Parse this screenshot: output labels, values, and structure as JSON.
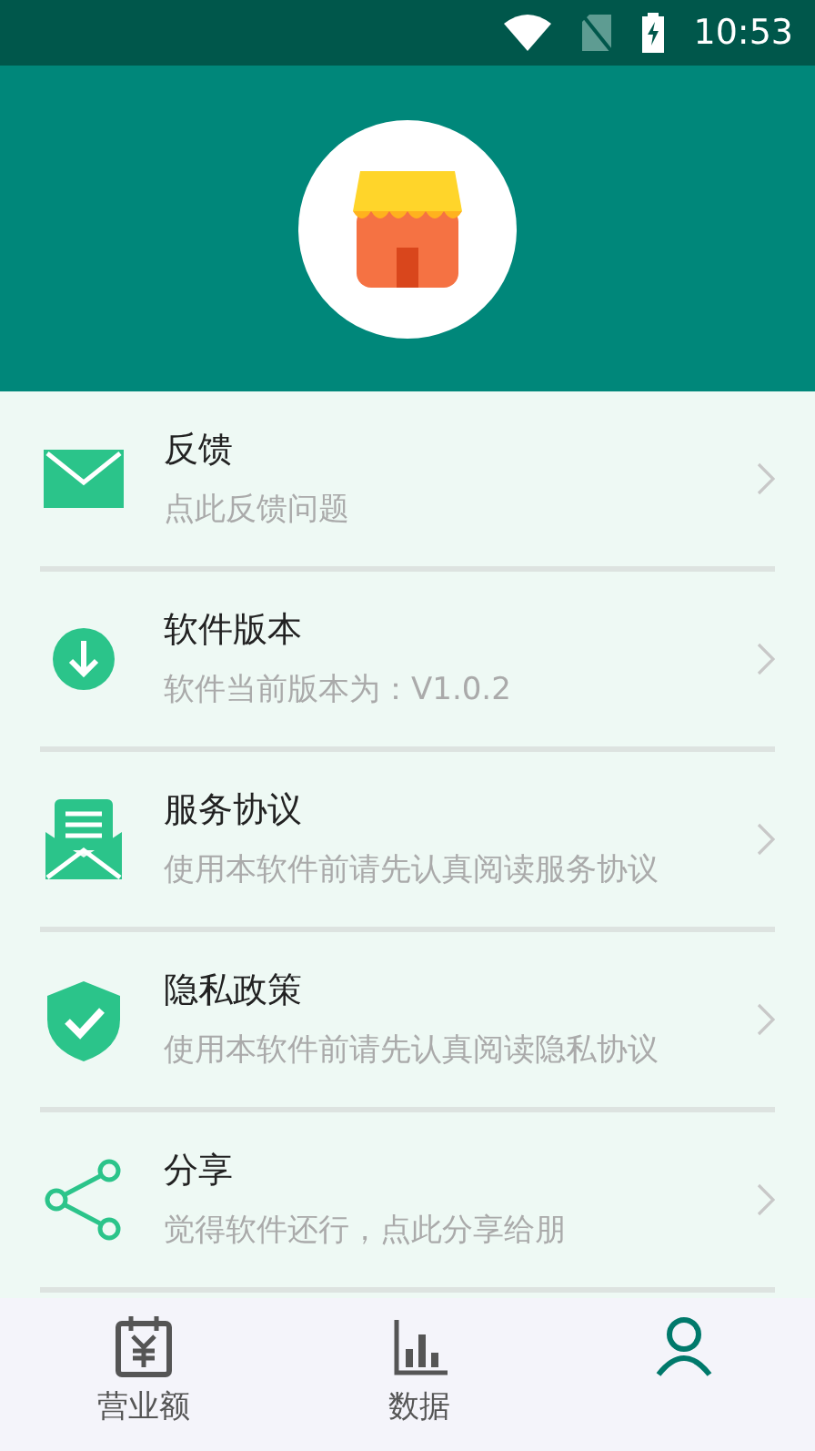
{
  "status_bar": {
    "time": "10:53"
  },
  "menu": [
    {
      "kind": "mail",
      "title": "反馈",
      "subtitle": "点此反馈问题"
    },
    {
      "kind": "download",
      "title": "软件版本",
      "subtitle": "软件当前版本为：V1.0.2"
    },
    {
      "kind": "document",
      "title": "服务协议",
      "subtitle": "使用本软件前请先认真阅读服务协议"
    },
    {
      "kind": "shield",
      "title": "隐私政策",
      "subtitle": "使用本软件前请先认真阅读隐私协议"
    },
    {
      "kind": "share",
      "title": "分享",
      "subtitle": "觉得软件还行，点此分享给朋"
    }
  ],
  "tabs": [
    {
      "kind": "revenue",
      "label": "营业额",
      "selected": false
    },
    {
      "kind": "chart",
      "label": "数据",
      "selected": false
    },
    {
      "kind": "person",
      "selected": true
    }
  ]
}
